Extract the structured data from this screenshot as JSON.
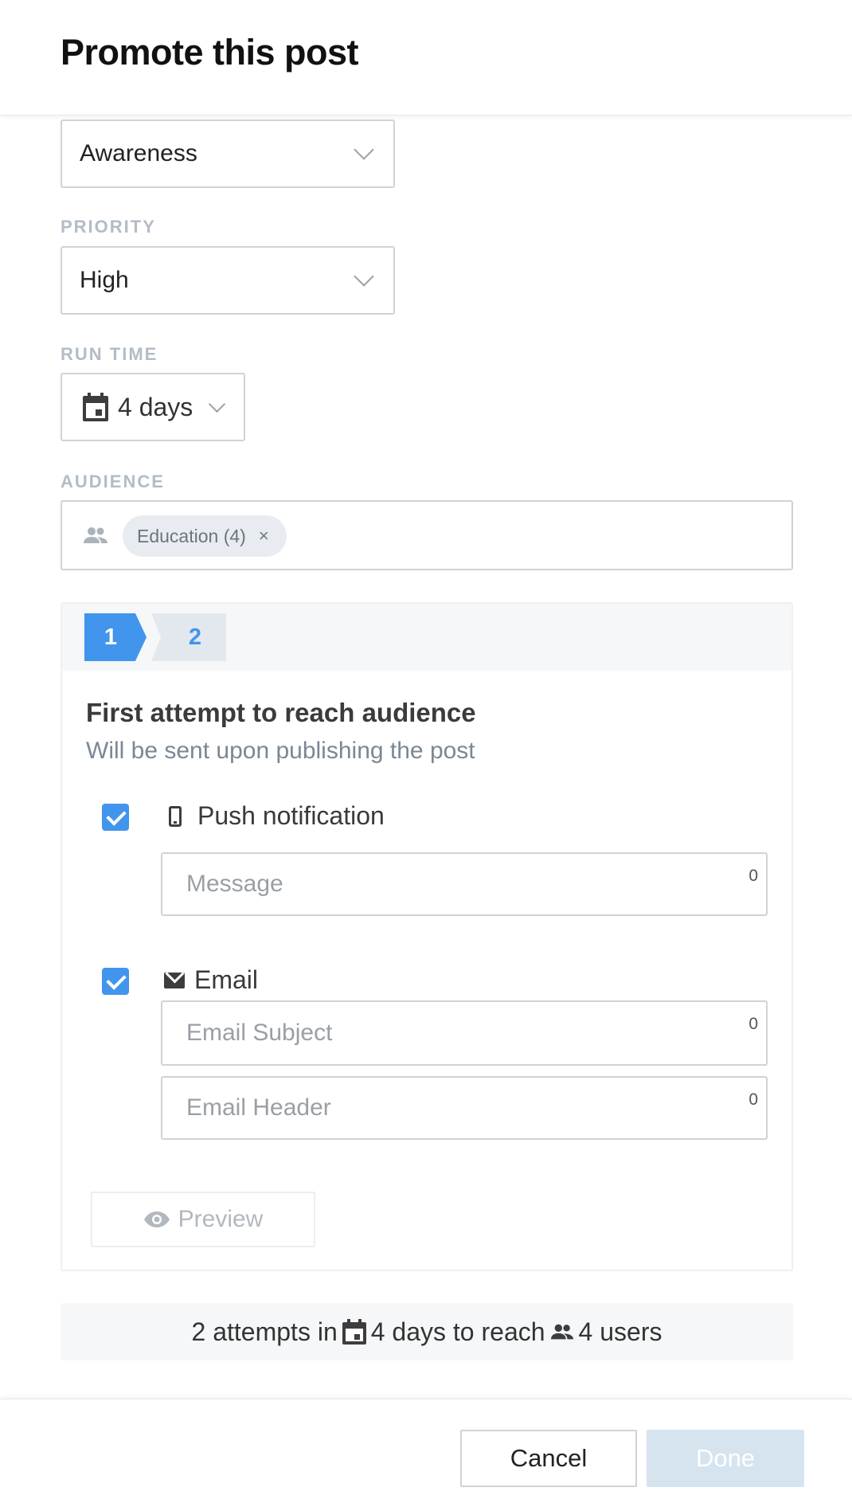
{
  "modal": {
    "title": "Promote this post"
  },
  "objective": {
    "value": "Awareness"
  },
  "priority": {
    "label": "PRIORITY",
    "value": "High"
  },
  "run_time": {
    "label": "RUN TIME",
    "value": "4 days"
  },
  "audience": {
    "label": "AUDIENCE",
    "chips": [
      {
        "label": "Education (4)",
        "remove": "×"
      }
    ]
  },
  "attempt_card": {
    "steps": [
      {
        "label": "1",
        "active": true
      },
      {
        "label": "2",
        "active": false
      }
    ],
    "title": "First attempt to reach audience",
    "subtitle": "Will be sent upon publishing the post",
    "push": {
      "label": "Push notification",
      "checked": true,
      "message_placeholder": "Message",
      "message_count": "0"
    },
    "email": {
      "label": "Email",
      "checked": true,
      "subject_placeholder": "Email Subject",
      "subject_count": "0",
      "header_placeholder": "Email Header",
      "header_count": "0"
    },
    "preview_label": "Preview"
  },
  "summary": {
    "part1": "2 attempts in",
    "part2": "4 days to reach",
    "part3": "4 users"
  },
  "footer": {
    "cancel_label": "Cancel",
    "done_label": "Done"
  },
  "colors": {
    "accent": "#4195ec",
    "done_disabled": "#d6e4f0",
    "label_gray": "#b3bcc6"
  }
}
